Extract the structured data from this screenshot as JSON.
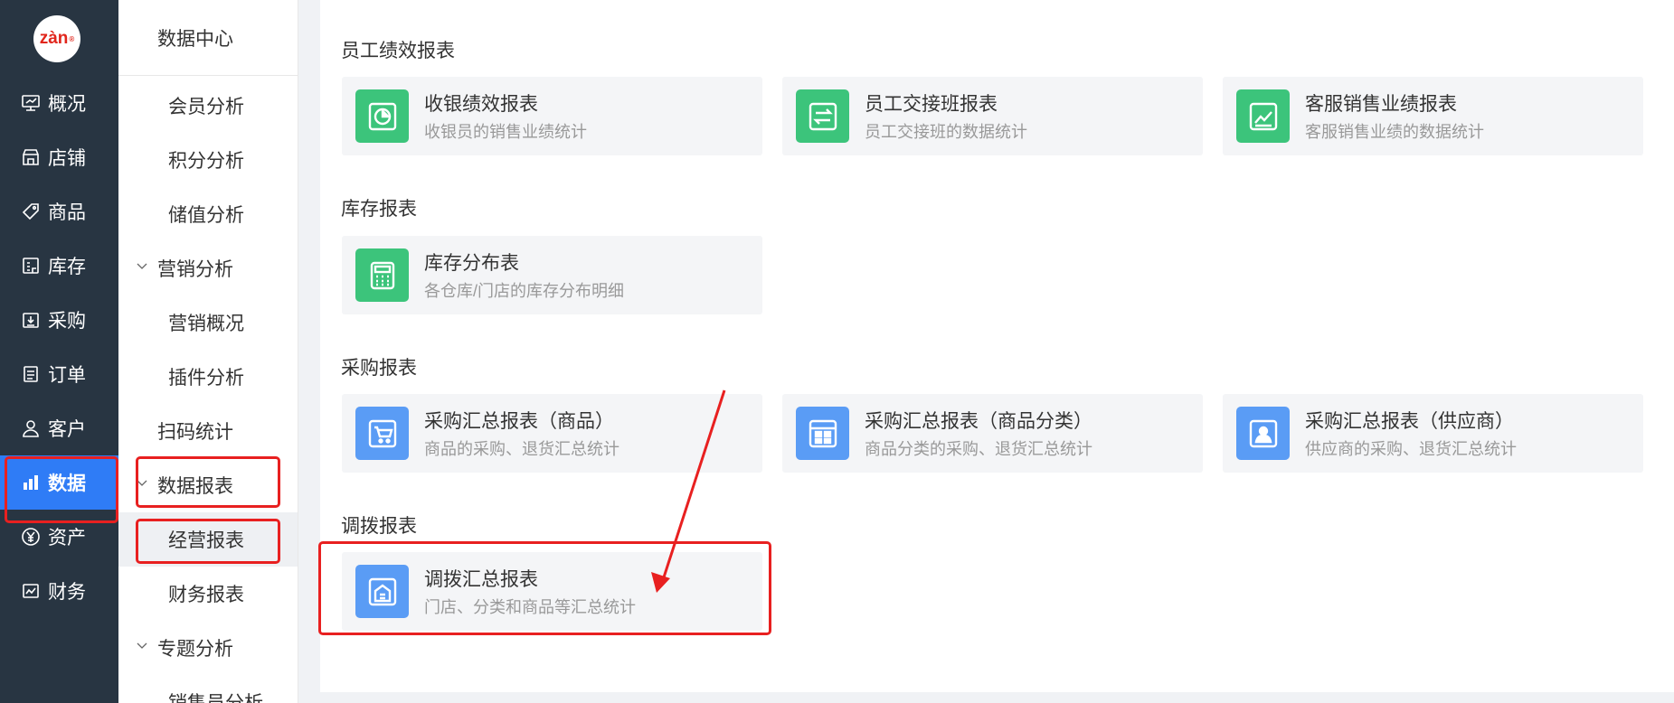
{
  "logo": {
    "text": "zàn",
    "reg": "®"
  },
  "main_nav": [
    {
      "label": "概况",
      "icon": "overview-icon"
    },
    {
      "label": "店铺",
      "icon": "store-icon"
    },
    {
      "label": "商品",
      "icon": "tag-icon"
    },
    {
      "label": "库存",
      "icon": "warehouse-icon"
    },
    {
      "label": "采购",
      "icon": "purchase-icon"
    },
    {
      "label": "订单",
      "icon": "order-icon"
    },
    {
      "label": "客户",
      "icon": "customer-icon"
    },
    {
      "label": "数据",
      "icon": "bar-chart-icon"
    },
    {
      "label": "资产",
      "icon": "yen-icon"
    },
    {
      "label": "财务",
      "icon": "finance-icon"
    }
  ],
  "sub_menu": {
    "title": "数据中心",
    "items": [
      {
        "label": "会员分析"
      },
      {
        "label": "积分分析"
      },
      {
        "label": "储值分析"
      },
      {
        "label": "营销分析"
      },
      {
        "label": "营销概况"
      },
      {
        "label": "插件分析"
      },
      {
        "label": "扫码统计"
      },
      {
        "label": "数据报表"
      },
      {
        "label": "经营报表"
      },
      {
        "label": "财务报表"
      },
      {
        "label": "专题分析"
      },
      {
        "label": "销售员分析"
      }
    ]
  },
  "sections": [
    {
      "title": "员工绩效报表",
      "cards": [
        {
          "name": "收银绩效报表",
          "desc": "收银员的销售业绩统计",
          "icon": "pie-chart-icon",
          "color": "#3cc47b"
        },
        {
          "name": "员工交接班报表",
          "desc": "员工交接班的数据统计",
          "icon": "exchange-icon",
          "color": "#3cc47b"
        },
        {
          "name": "客服销售业绩报表",
          "desc": "客服销售业绩的数据统计",
          "icon": "trend-chart-icon",
          "color": "#3cc47b"
        }
      ]
    },
    {
      "title": "库存报表",
      "cards": [
        {
          "name": "库存分布表",
          "desc": "各仓库/门店的库存分布明细",
          "icon": "calculator-icon",
          "color": "#3cc47b"
        }
      ]
    },
    {
      "title": "采购报表",
      "cards": [
        {
          "name": "采购汇总报表（商品）",
          "desc": "商品的采购、退货汇总统计",
          "icon": "cart-icon",
          "color": "#5a9cf5"
        },
        {
          "name": "采购汇总报表（商品分类）",
          "desc": "商品分类的采购、退货汇总统计",
          "icon": "grid-layout-icon",
          "color": "#5a9cf5"
        },
        {
          "name": "采购汇总报表（供应商）",
          "desc": "供应商的采购、退货汇总统计",
          "icon": "supplier-icon",
          "color": "#5a9cf5"
        }
      ]
    },
    {
      "title": "调拨报表",
      "cards": [
        {
          "name": "调拨汇总报表",
          "desc": "门店、分类和商品等汇总统计",
          "icon": "transfer-house-icon",
          "color": "#5a9cf5"
        }
      ]
    }
  ],
  "colors": {
    "sidebar": "#283542",
    "active": "#2f7cf6",
    "annotation": "#e82020"
  }
}
